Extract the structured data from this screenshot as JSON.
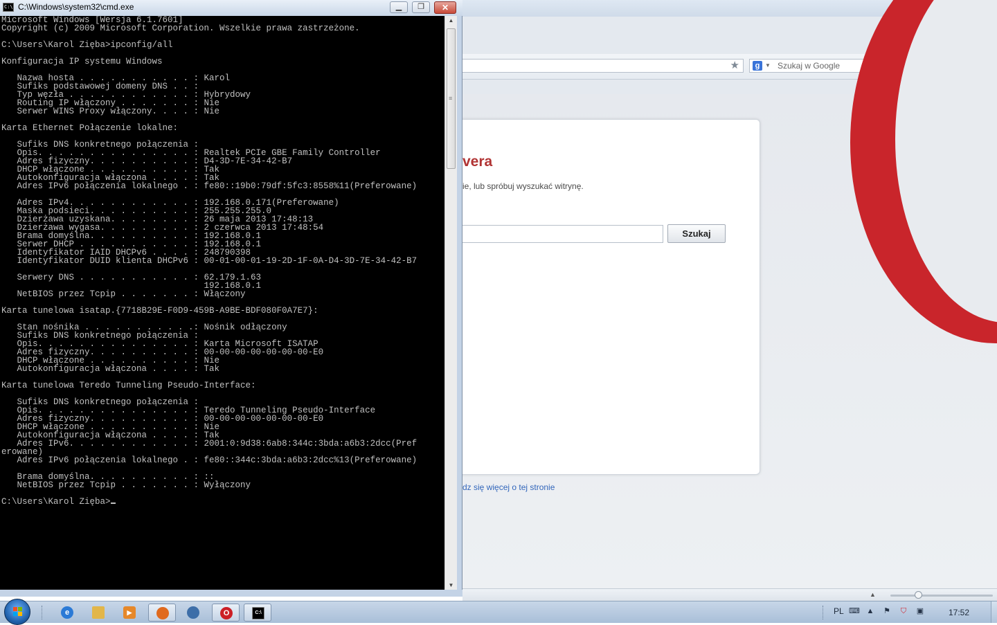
{
  "opera": {
    "search_placeholder": "Szukaj w Google",
    "error_heading": "vera",
    "error_text": "ie, lub spróbuj wyszukać witrynę.",
    "search_button": "Szukaj",
    "learn_more": "dz się więcej o tej stronie",
    "accent_color": "#c9252b"
  },
  "cmd": {
    "title": "C:\\Windows\\system32\\cmd.exe",
    "lines": [
      "Microsoft Windows [Wersja 6.1.7601]",
      "Copyright (c) 2009 Microsoft Corporation. Wszelkie prawa zastrzeżone.",
      "",
      "C:\\Users\\Karol Zięba>ipconfig/all",
      "",
      "Konfiguracja IP systemu Windows",
      "",
      "   Nazwa hosta . . . . . . . . . . . : Karol",
      "   Sufiks podstawowej domeny DNS . . :",
      "   Typ węzła . . . . . . . . . . . . : Hybrydowy",
      "   Routing IP włączony . . . . . . . : Nie",
      "   Serwer WINS Proxy włączony. . . . : Nie",
      "",
      "Karta Ethernet Połączenie lokalne:",
      "",
      "   Sufiks DNS konkretnego połączenia :",
      "   Opis. . . . . . . . . . . . . . . : Realtek PCIe GBE Family Controller",
      "   Adres fizyczny. . . . . . . . . . : D4-3D-7E-34-42-B7",
      "   DHCP włączone . . . . . . . . . . : Tak",
      "   Autokonfiguracja włączona . . . . : Tak",
      "   Adres IPv6 połączenia lokalnego . : fe80::19b0:79df:5fc3:8558%11(Preferowane)",
      "",
      "   Adres IPv4. . . . . . . . . . . . : 192.168.0.171(Preferowane)",
      "   Maska podsieci. . . . . . . . . . : 255.255.255.0",
      "   Dzierżawa uzyskana. . . . . . . . : 26 maja 2013 17:48:13",
      "   Dzierżawa wygasa. . . . . . . . . : 2 czerwca 2013 17:48:54",
      "   Brama domyślna. . . . . . . . . . : 192.168.0.1",
      "   Serwer DHCP . . . . . . . . . . . : 192.168.0.1",
      "   Identyfikator IAID DHCPv6 . . . . : 248790398",
      "   Identyfikator DUID klienta DHCPv6 : 00-01-00-01-19-2D-1F-0A-D4-3D-7E-34-42-B7",
      "",
      "   Serwery DNS . . . . . . . . . . . : 62.179.1.63",
      "                                       192.168.0.1",
      "   NetBIOS przez Tcpip . . . . . . . : Włączony",
      "",
      "Karta tunelowa isatap.{7718B29E-F0D9-459B-A9BE-BDF080F0A7E7}:",
      "",
      "   Stan nośnika . . . . . . . . . . .: Nośnik odłączony",
      "   Sufiks DNS konkretnego połączenia :",
      "   Opis. . . . . . . . . . . . . . . : Karta Microsoft ISATAP",
      "   Adres fizyczny. . . . . . . . . . : 00-00-00-00-00-00-00-E0",
      "   DHCP włączone . . . . . . . . . . : Nie",
      "   Autokonfiguracja włączona . . . . : Tak",
      "",
      "Karta tunelowa Teredo Tunneling Pseudo-Interface:",
      "",
      "   Sufiks DNS konkretnego połączenia :",
      "   Opis. . . . . . . . . . . . . . . : Teredo Tunneling Pseudo-Interface",
      "   Adres fizyczny. . . . . . . . . . : 00-00-00-00-00-00-00-E0",
      "   DHCP włączone . . . . . . . . . . : Nie",
      "   Autokonfiguracja włączona . . . . : Tak",
      "   Adres IPv6. . . . . . . . . . . . : 2001:0:9d38:6ab8:344c:3bda:a6b3:2dcc(Pref",
      "erowane)",
      "   Adres IPv6 połączenia lokalnego . : fe80::344c:3bda:a6b3:2dcc%13(Preferowane)",
      "",
      "   Brama domyślna. . . . . . . . . . : ::",
      "   NetBIOS przez Tcpip . . . . . . . : Wyłączony",
      "",
      "C:\\Users\\Karol Zięba>"
    ]
  },
  "taskbar": {
    "language": "PL",
    "clock": "17:52"
  }
}
